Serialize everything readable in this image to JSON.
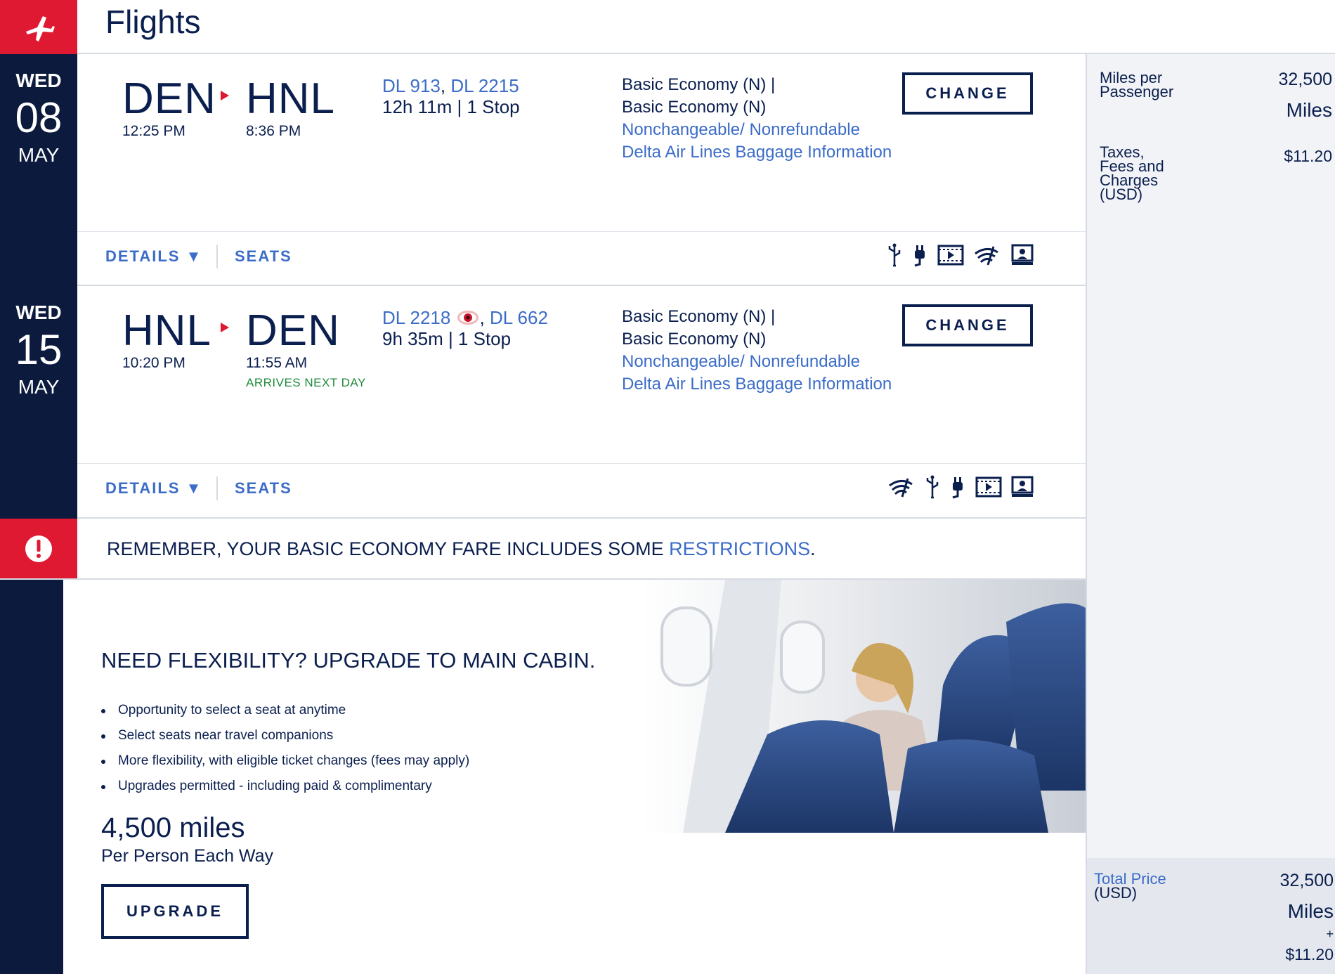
{
  "header": {
    "title": "Flights",
    "icon": "plane-icon",
    "accent": "#e01933"
  },
  "flights": [
    {
      "date": {
        "dow": "WED",
        "day": "08",
        "month": "MAY"
      },
      "origin": "DEN",
      "origin_time": "12:25 PM",
      "destination": "HNL",
      "destination_time": "8:36 PM",
      "flight_numbers": [
        "DL 913",
        "DL 2215"
      ],
      "duration": "12h 11m | 1 Stop",
      "fare_line1": "Basic Economy (N) |",
      "fare_line2": "Basic Economy (N)",
      "fare_rules": "Nonchangeable/ Nonrefundable",
      "baggage": "Delta Air Lines Baggage Information",
      "change_label": "CHANGE",
      "details_label": "DETAILS ▼",
      "seats_label": "SEATS",
      "amenities": [
        "usb-icon",
        "power-icon",
        "video-icon",
        "wifi-icon",
        "seatback-screen-icon"
      ]
    },
    {
      "date": {
        "dow": "WED",
        "day": "15",
        "month": "MAY"
      },
      "origin": "HNL",
      "origin_time": "10:20 PM",
      "destination": "DEN",
      "destination_time": "11:55 AM",
      "arrives_note": "ARRIVES NEXT DAY",
      "flight_numbers": [
        "DL 2218",
        "DL 662"
      ],
      "redeye_icon": "red-eye-icon",
      "duration": "9h 35m | 1 Stop",
      "fare_line1": "Basic Economy (N) |",
      "fare_line2": "Basic Economy (N)",
      "fare_rules": "Nonchangeable/ Nonrefundable",
      "baggage": "Delta Air Lines Baggage Information",
      "change_label": "CHANGE",
      "details_label": "DETAILS ▼",
      "seats_label": "SEATS",
      "amenities": [
        "wifi-icon",
        "usb-icon",
        "power-icon",
        "video-icon",
        "seatback-screen-icon"
      ]
    }
  ],
  "notice": {
    "text": "REMEMBER, YOUR BASIC ECONOMY FARE INCLUDES SOME ",
    "link": "RESTRICTIONS",
    "end": "."
  },
  "promo": {
    "title": "NEED FLEXIBILITY? UPGRADE TO MAIN CABIN.",
    "bullets": [
      "Opportunity to select a seat at anytime",
      "Select seats near travel companions",
      "More flexibility, with eligible ticket changes (fees may apply)",
      "Upgrades permitted - including paid & complimentary"
    ],
    "miles": "4,500 miles",
    "per": "Per Person Each Way",
    "button": "UPGRADE"
  },
  "summary": {
    "miles_label_1": "Miles per",
    "miles_label_2": "Passenger",
    "miles_value": "32,500",
    "miles_unit": "Miles",
    "taxes_label_1": "Taxes,",
    "taxes_label_2": "Fees and",
    "taxes_label_3": "Charges",
    "taxes_label_4": "(USD)",
    "taxes_value": "$11.20",
    "total_label": "Total Price",
    "total_label_2": "(USD)",
    "total_miles": "32,500",
    "total_unit": "Miles",
    "plus": "+",
    "total_cash": "$11.20"
  },
  "colors": {
    "navy": "#0b1a3d",
    "link": "#3b6cc8",
    "red": "#e01933",
    "green": "#1e8a3a"
  }
}
